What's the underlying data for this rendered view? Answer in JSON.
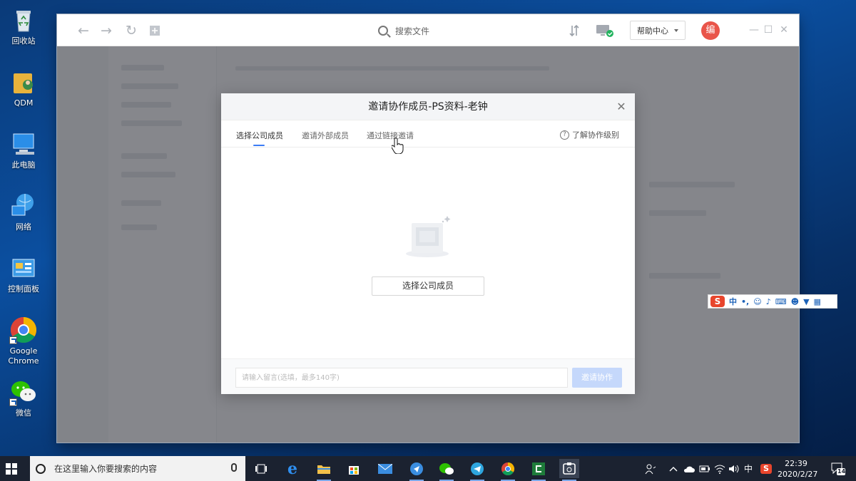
{
  "desktop": {
    "icons": [
      {
        "label": "回收站",
        "icon": "recycle-bin-icon"
      },
      {
        "label": "QDM",
        "icon": "qdm-folder-icon"
      },
      {
        "label": "此电脑",
        "icon": "computer-icon"
      },
      {
        "label": "网络",
        "icon": "network-icon"
      },
      {
        "label": "控制面板",
        "icon": "control-panel-icon"
      },
      {
        "label": "Google\nChrome",
        "icon": "chrome-icon"
      },
      {
        "label": "微信",
        "icon": "wechat-icon"
      }
    ]
  },
  "app": {
    "search_label": "搜索文件",
    "help_label": "帮助中心",
    "avatar_text": "编"
  },
  "modal": {
    "title": "邀请协作成员-PS资料-老钟",
    "tabs": [
      {
        "label": "选择公司成员",
        "active": true
      },
      {
        "label": "邀请外部成员",
        "active": false
      },
      {
        "label": "通过链接邀请",
        "active": false
      }
    ],
    "help_link": "了解协作级别",
    "select_button": "选择公司成员",
    "message_placeholder": "请输入留言(选填，最多140字)",
    "invite_button": "邀请协作"
  },
  "ime": {
    "logo": "S",
    "mode": "中"
  },
  "taskbar": {
    "search_placeholder": "在这里输入你要搜索的内容",
    "tray_ime": "中",
    "time": "22:39",
    "date": "2020/2/27",
    "notification_count": "14"
  },
  "colors": {
    "accent": "#3b7cf5",
    "invite_disabled": "#c5d8fb",
    "avatar": "#e9554a",
    "taskbar": "#1b2230"
  }
}
